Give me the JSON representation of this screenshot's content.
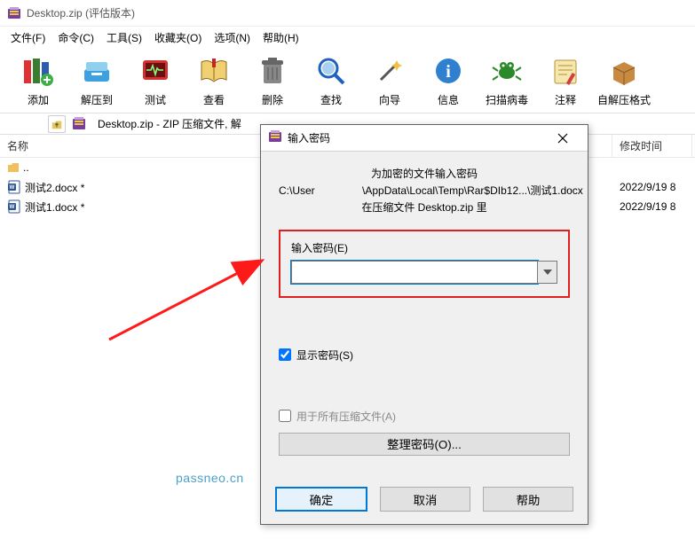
{
  "titlebar": {
    "title": "Desktop.zip (评估版本)"
  },
  "menubar": {
    "file": "文件(F)",
    "command": "命令(C)",
    "tools": "工具(S)",
    "favorites": "收藏夹(O)",
    "options": "选项(N)",
    "help": "帮助(H)"
  },
  "toolbar": {
    "add": "添加",
    "extract": "解压到",
    "test": "测试",
    "view": "查看",
    "delete": "删除",
    "find": "查找",
    "wizard": "向导",
    "info": "信息",
    "scan": "扫描病毒",
    "comment": "注释",
    "sfx": "自解压格式"
  },
  "pathbar": {
    "text": "Desktop.zip - ZIP 压缩文件, 解"
  },
  "columns": {
    "name": "名称",
    "mtime": "修改时间"
  },
  "rows": [
    {
      "name": "..",
      "icon": "folder",
      "mtime": ""
    },
    {
      "name": "测试2.docx *",
      "icon": "doc",
      "mtime": "2022/9/19 8"
    },
    {
      "name": "测试1.docx *",
      "icon": "doc",
      "mtime": "2022/9/19 8"
    }
  ],
  "dialog": {
    "title": "输入密码",
    "line1": "为加密的文件输入密码",
    "line2": "C:\\User                \\AppData\\Local\\Temp\\Rar$DIb12...\\测试1.docx",
    "line3": "在压缩文件 Desktop.zip 里",
    "field_label": "输入密码(E)",
    "value": "",
    "show_pwd": "显示密码(S)",
    "use_all": "用于所有压缩文件(A)",
    "organize": "整理密码(O)...",
    "ok": "确定",
    "cancel": "取消",
    "help": "帮助"
  },
  "watermark": "passneo.cn"
}
